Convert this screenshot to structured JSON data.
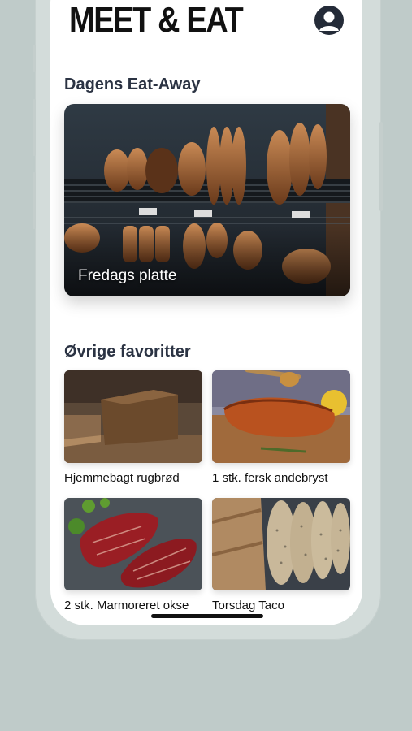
{
  "app": {
    "logo": "MEET & EAT",
    "profile_icon": "user-avatar-icon"
  },
  "today": {
    "section_title": "Dagens Eat-Away",
    "hero_caption": "Fredags platte"
  },
  "favorites": {
    "section_title": "Øvrige favoritter",
    "items": [
      {
        "label": "Hjemmebagt rugbrød"
      },
      {
        "label": "1 stk. fersk andebryst"
      },
      {
        "label": "2 stk. Marmoreret okse"
      },
      {
        "label": "Torsdag Taco"
      }
    ]
  },
  "colors": {
    "background": "#bfcbc9",
    "title": "#2b3343",
    "avatar": "#242b38"
  }
}
